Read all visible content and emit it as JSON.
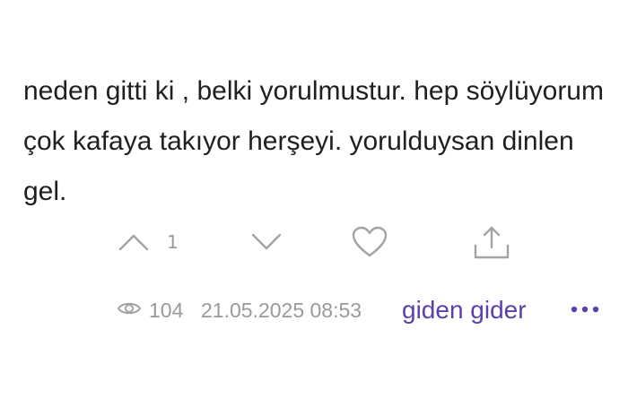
{
  "entry": {
    "text": "neden gitti ki , belki yorulmustur. hep söylüyorum çok kafaya takıyor herşeyi. yorulduysan dinlen gel."
  },
  "actions": {
    "upvote_count": "1",
    "icons": [
      "chevron-up-icon",
      "chevron-down-icon",
      "heart-icon",
      "share-icon"
    ]
  },
  "meta": {
    "views": "104",
    "date": "21.05.2025 08:53",
    "author": "giden gider",
    "more_icon": "more-horizontal-icon"
  },
  "colors": {
    "text": "#1f1f1f",
    "muted": "#9a9a9a",
    "icon": "#a3a3a3",
    "author": "#5b3fae"
  }
}
